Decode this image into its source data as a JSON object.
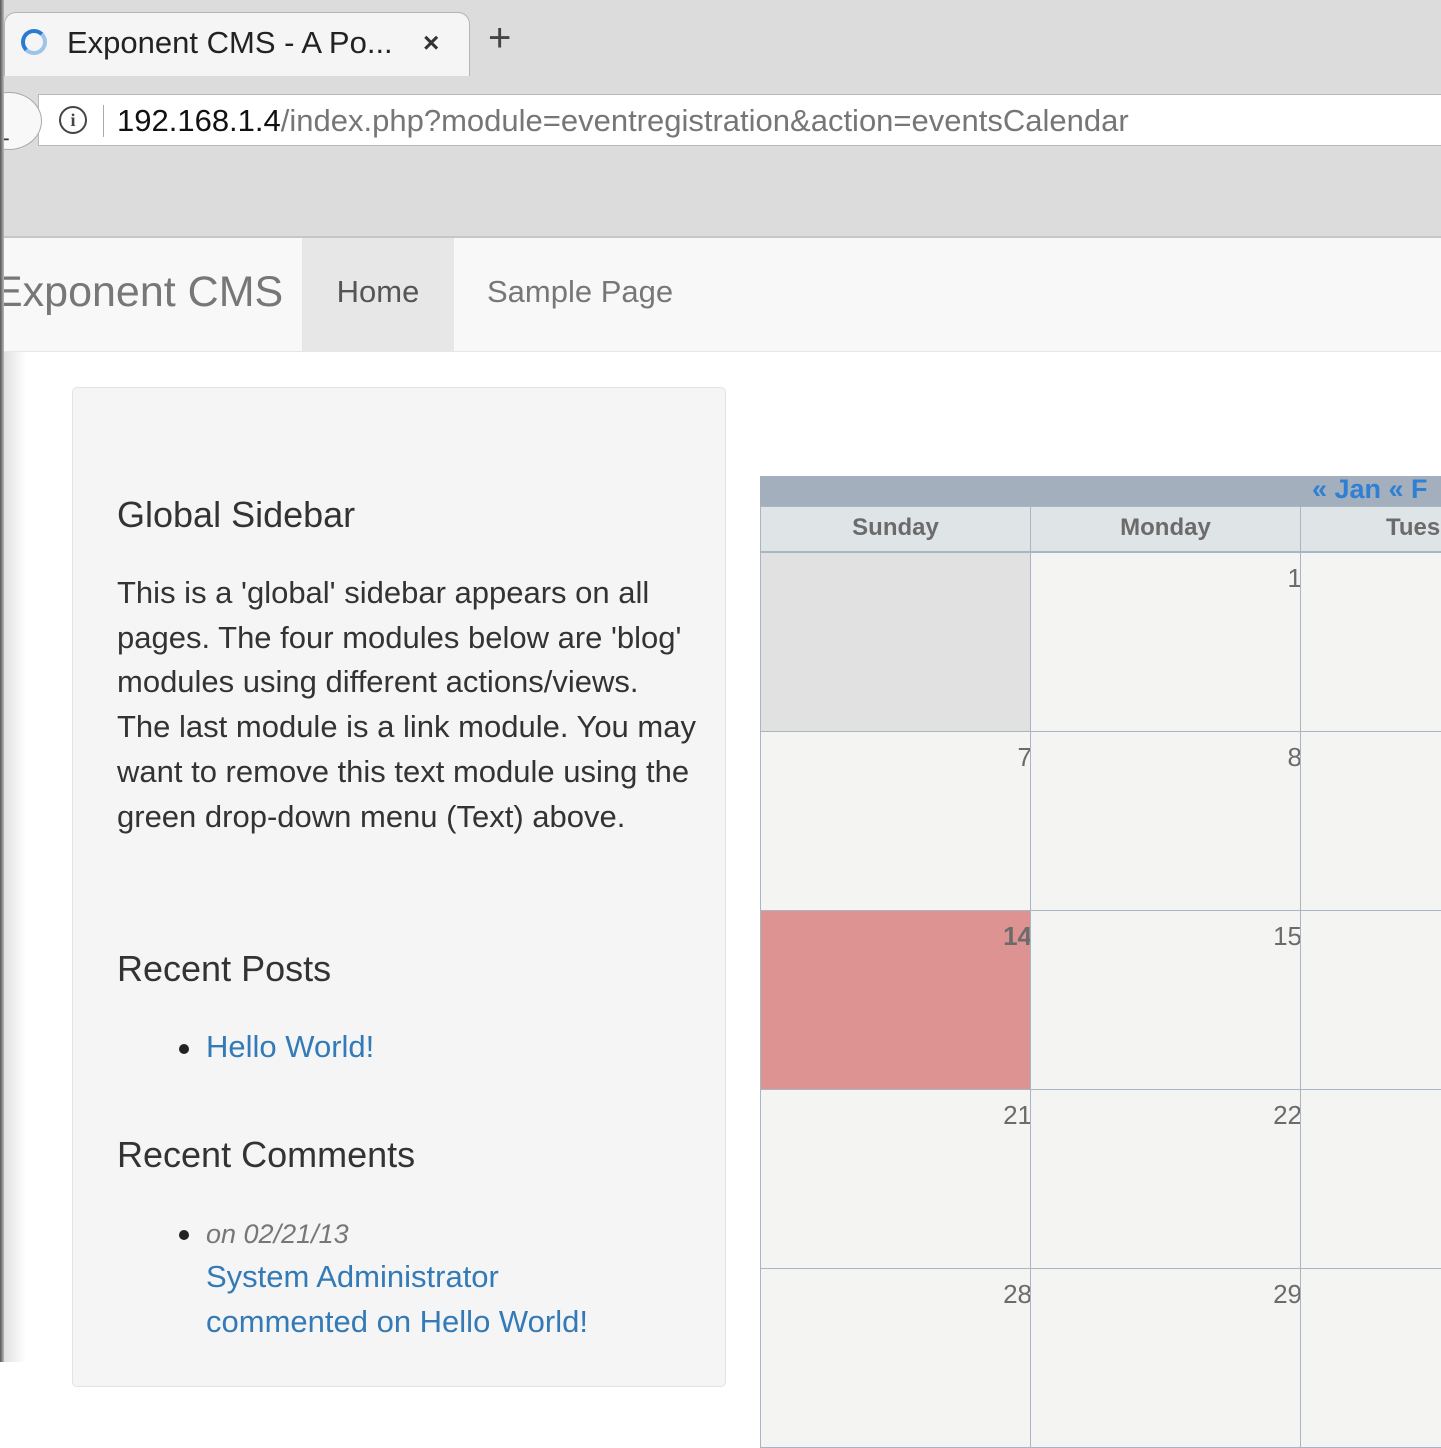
{
  "browser": {
    "tab_title": "Exponent CMS - A Po...",
    "tab_close": "×",
    "new_tab": "+",
    "url_host": "192.168.1.4",
    "url_path": "/index.php?module=eventregistration&action=eventsCalendar",
    "icons": {
      "loading": "spinner-icon",
      "info": "info-icon",
      "back": "back-arrow-icon"
    }
  },
  "navbar": {
    "brand": "Exponent CMS",
    "items": [
      {
        "label": "Home",
        "active": true
      },
      {
        "label": "Sample Page",
        "active": false
      }
    ]
  },
  "sidebar": {
    "title": "Global Sidebar",
    "description": "This is a 'global' sidebar appears on all pages.  The four modules below are 'blog' modules using different actions/views.  The last module is a link module.  You may want to remove this text module using the green drop-down menu (Text) above.",
    "recent_posts": {
      "heading": "Recent Posts",
      "items": [
        "Hello World!"
      ]
    },
    "recent_comments": {
      "heading": "Recent Comments",
      "items": [
        {
          "date": "on 02/21/13",
          "line1": "System Administrator",
          "line2": "commented on Hello World!"
        }
      ]
    }
  },
  "calendar": {
    "nav_text": "« Jan « F",
    "day_names": [
      "Sunday",
      "Monday",
      "Tues"
    ],
    "weeks": [
      [
        "",
        "1",
        ""
      ],
      [
        "7",
        "8",
        ""
      ],
      [
        "14",
        "15",
        ""
      ],
      [
        "21",
        "22",
        ""
      ],
      [
        "28",
        "29",
        ""
      ]
    ],
    "today": "14",
    "colors": {
      "today": "#de9393",
      "empty": "#e1e1e1",
      "cell": "#f4f4f2",
      "header": "#a3afbd"
    }
  }
}
